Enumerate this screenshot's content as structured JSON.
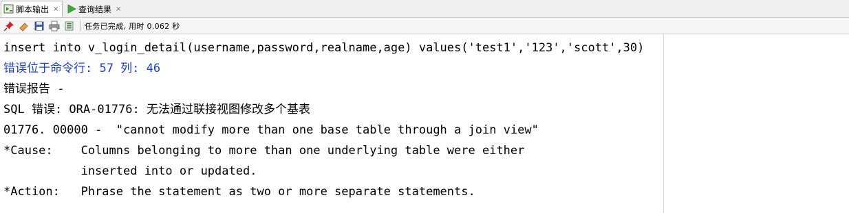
{
  "tabs": [
    {
      "label": "脚本输出",
      "close": "×",
      "active": true,
      "icon": "script-output-icon"
    },
    {
      "label": "查询结果",
      "close": "×",
      "active": false,
      "icon": "run-query-icon"
    }
  ],
  "toolbar": {
    "buttons": [
      "pin-icon",
      "eraser-icon",
      "save-icon",
      "print-icon",
      "export-icon"
    ],
    "status": "任务已完成, 用时 0.062 秒"
  },
  "output": {
    "lines": [
      {
        "text": "insert into v_login_detail(username,password,realname,age) values('test1','123','scott',30)",
        "color": "#000000"
      },
      {
        "text": "错误位于命令行: 57 列: 46",
        "color": "#1a3fd0"
      },
      {
        "text": "错误报告 -",
        "color": "#000000"
      },
      {
        "text": "SQL 错误: ORA-01776: 无法通过联接视图修改多个基表",
        "color": "#000000"
      },
      {
        "text": "01776. 00000 -  \"cannot modify more than one base table through a join view\"",
        "color": "#000000"
      },
      {
        "text": "*Cause:    Columns belonging to more than one underlying table were either",
        "color": "#000000"
      },
      {
        "text": "           inserted into or updated.",
        "color": "#000000"
      },
      {
        "text": "*Action:   Phrase the statement as two or more separate statements.",
        "color": "#000000"
      }
    ]
  }
}
